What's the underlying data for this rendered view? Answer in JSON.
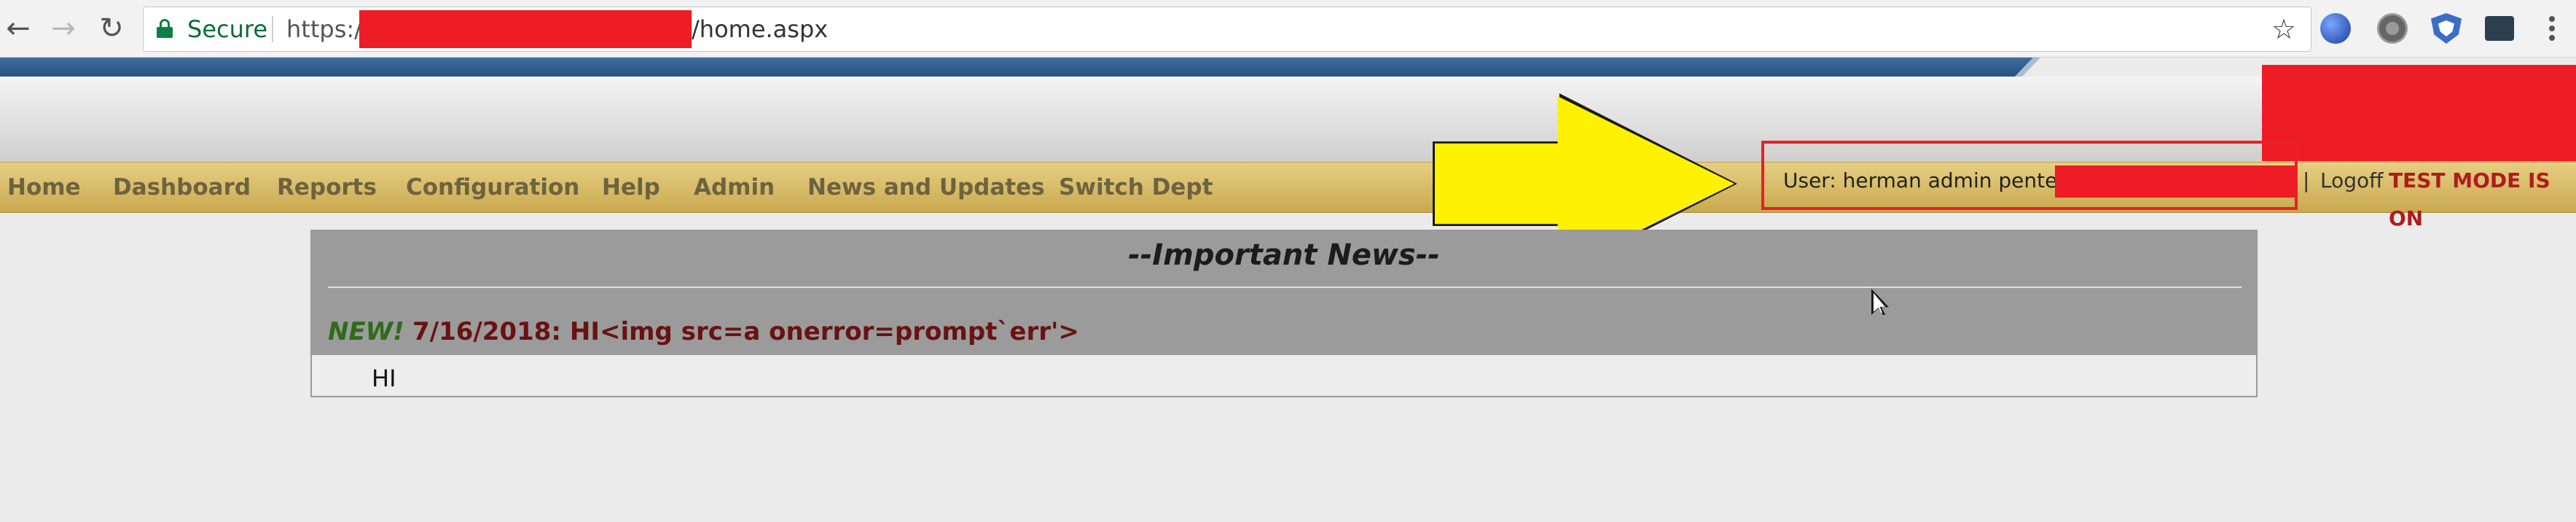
{
  "browser": {
    "secure_label": "Secure",
    "url_prefix": "https://",
    "url_suffix": "/home.aspx",
    "icons": [
      "back-icon",
      "forward-icon",
      "reload-icon",
      "lock-icon",
      "star-icon",
      "globe-icon",
      "gear-icon",
      "shield-icon",
      "briefcase-icon",
      "kebab-menu-icon"
    ]
  },
  "nav": {
    "items": [
      {
        "label": "Home"
      },
      {
        "label": "Dashboard"
      },
      {
        "label": "Reports"
      },
      {
        "label": "Configuration"
      },
      {
        "label": "Help"
      },
      {
        "label": "Admin"
      },
      {
        "label": "News and Updates"
      },
      {
        "label": "Switch Dept"
      }
    ]
  },
  "user": {
    "label": "User: herman admin pentest/",
    "separator": "|",
    "logoff": "Logoff",
    "test_mode": "TEST MODE IS ON"
  },
  "news": {
    "title": "--Important News--",
    "new_badge": "NEW!",
    "headline": "7/16/2018: HI<img src=a onerror=prompt`err'>",
    "body": "HI"
  },
  "colors": {
    "nav_gold": "#d8bd67",
    "nav_text": "#6d6340",
    "alert_red": "#b01c1c",
    "redaction": "#ee1c25",
    "annotation_arrow": "#fff200",
    "news_header": "#9b9b9b",
    "new_green": "#2f6c1a",
    "headline_maroon": "#6a1212"
  }
}
